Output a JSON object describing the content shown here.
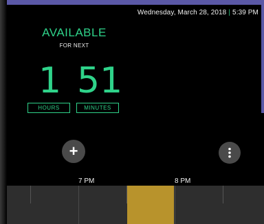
{
  "header": {
    "date": "Wednesday, March 28, 2018",
    "separator": "|",
    "time": "5:39 PM"
  },
  "status": {
    "title": "AVAILABLE",
    "subtitle": "FOR NEXT",
    "hours_value": "1",
    "minutes_value": "51",
    "hours_label": "HOURS",
    "minutes_label": "MINUTES"
  },
  "actions": {
    "add_symbol": "+",
    "add_icon": "plus-icon",
    "more_icon": "vertical-dots-icon"
  },
  "timeline": {
    "labels": [
      "7 PM",
      "8 PM"
    ],
    "booked_color": "#b8932c"
  },
  "colors": {
    "accent": "#2fd38a",
    "frame": "#5a58a6",
    "background": "#000000"
  }
}
